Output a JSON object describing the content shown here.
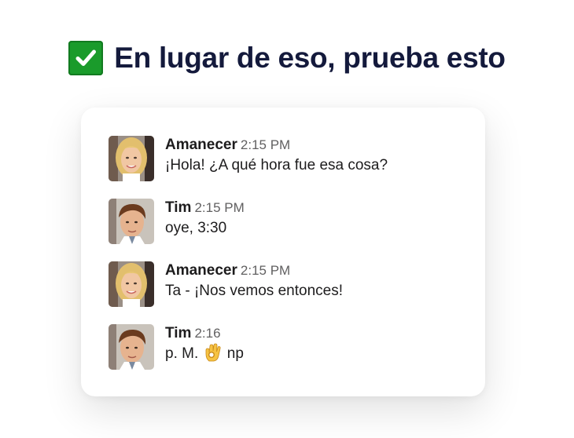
{
  "heading": {
    "icon": "check-mark-button-icon",
    "text": "En lugar de eso, prueba esto"
  },
  "messages": [
    {
      "author": "Amanecer",
      "time": "2:15 PM",
      "text": "¡Hola! ¿A qué hora fue esa cosa?",
      "avatar": "woman-avatar"
    },
    {
      "author": "Tim",
      "time": "2:15 PM",
      "text": "oye, 3:30",
      "avatar": "man-avatar"
    },
    {
      "author": "Amanecer",
      "time": "2:15 PM",
      "text": "Ta - ¡Nos vemos entonces!",
      "avatar": "woman-avatar"
    },
    {
      "author": "Tim",
      "time": "2:16",
      "text_before": "p. M.",
      "emoji": "ok-hand-icon",
      "text_after": "np",
      "avatar": "man-avatar"
    }
  ],
  "colors": {
    "heading": "#141a3c",
    "check_green": "#1a9b2b",
    "timestamp": "#616061"
  }
}
